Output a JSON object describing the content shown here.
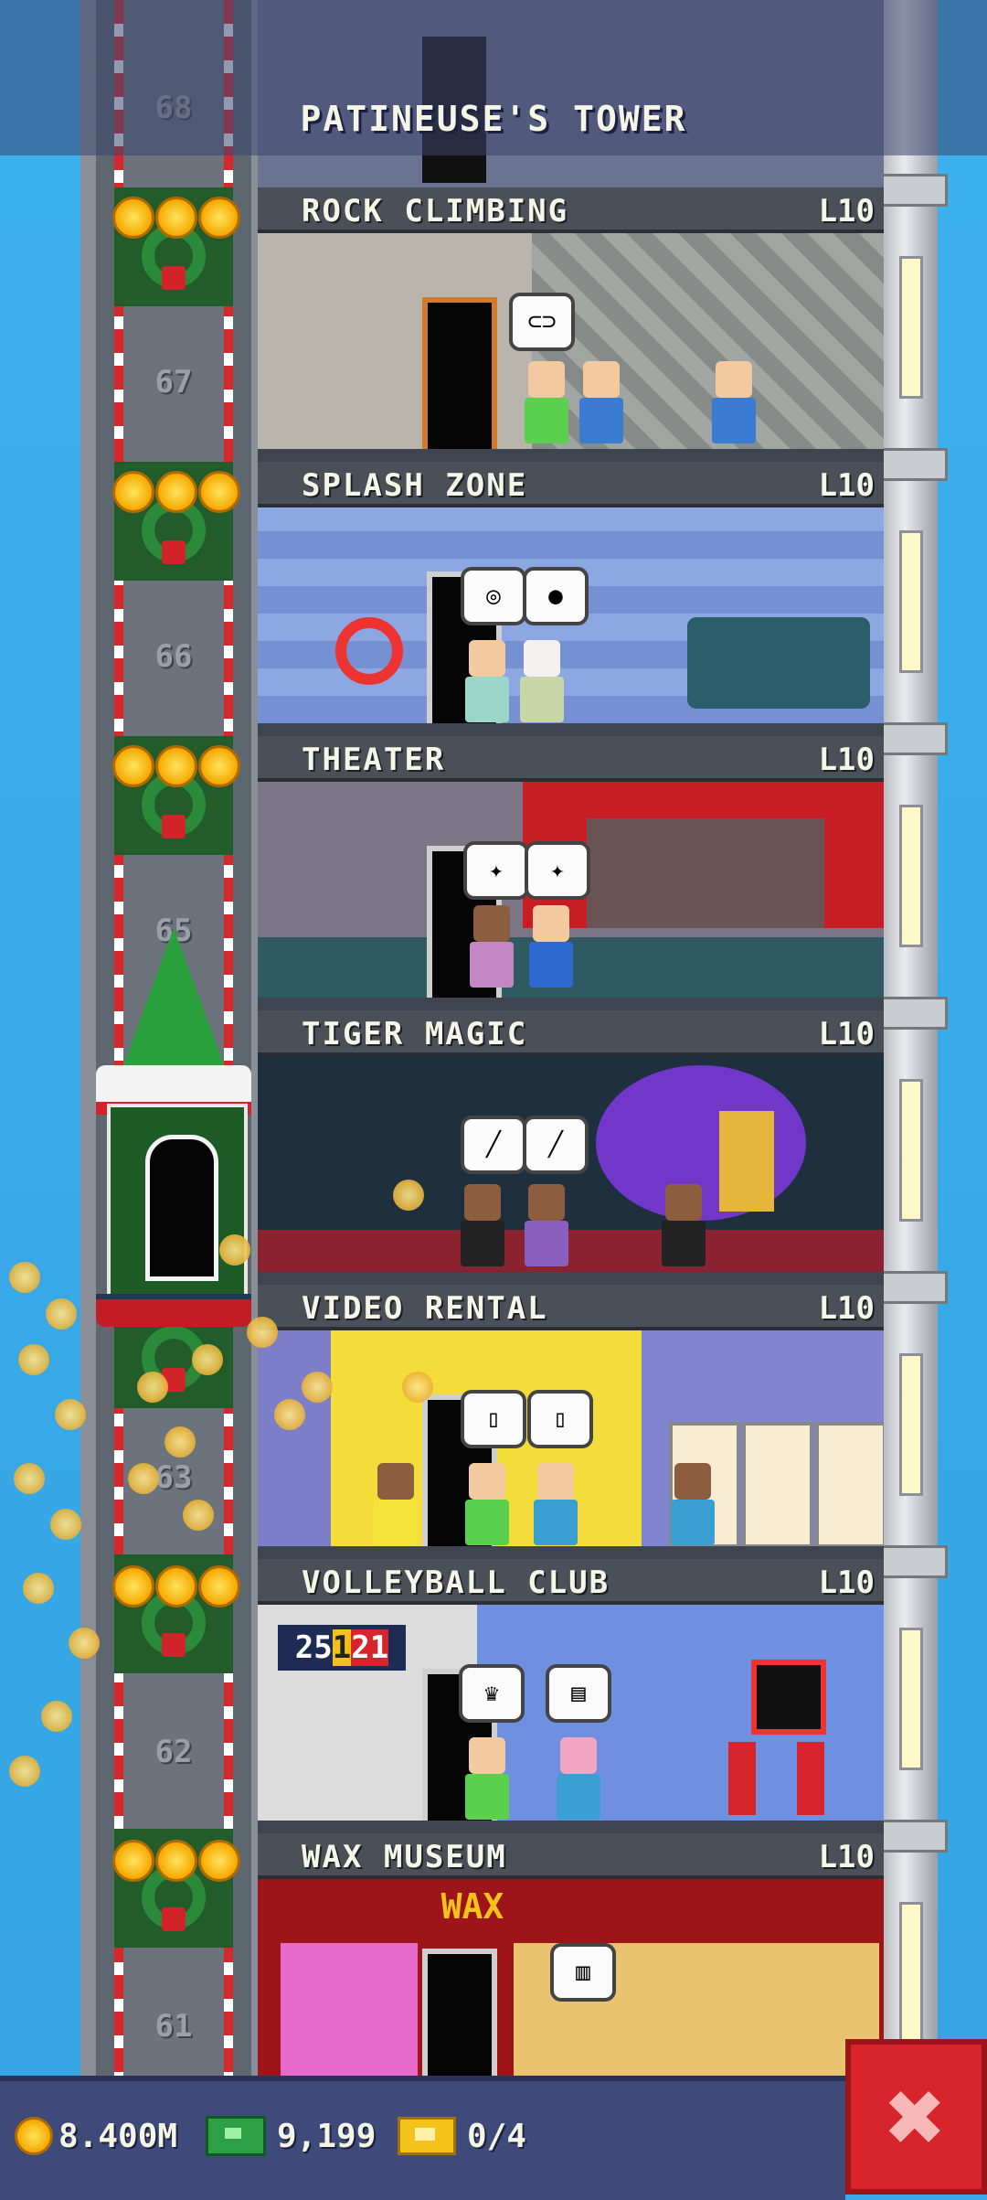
{
  "header": {
    "title": "PATINEUSE'S TOWER"
  },
  "elevator": {
    "floor_numbers": [
      "68",
      "67",
      "66",
      "65",
      "63",
      "62",
      "61"
    ]
  },
  "floors": [
    {
      "name": "ROCK CLIMBING",
      "level": "L10"
    },
    {
      "name": "SPLASH ZONE",
      "level": "L10"
    },
    {
      "name": "THEATER",
      "level": "L10"
    },
    {
      "name": "TIGER MAGIC",
      "level": "L10"
    },
    {
      "name": "VIDEO RENTAL",
      "level": "L10"
    },
    {
      "name": "VOLLEYBALL CLUB",
      "level": "L10"
    },
    {
      "name": "WAX MUSEUM",
      "level": "L10"
    }
  ],
  "scoreboard": {
    "left": "25",
    "mid": "1",
    "right": "21"
  },
  "wax_sign": "WAX",
  "status": {
    "coins": "8.400M",
    "bux": "9,199",
    "tickets": "0/4"
  },
  "colors": {
    "accent": "#d8252c",
    "sky": "#3aa7e8",
    "bar": "#3e4a7a"
  },
  "icons": {
    "close": "close-icon",
    "coin": "coin-icon",
    "bux": "bux-icon",
    "ticket": "ticket-icon"
  }
}
